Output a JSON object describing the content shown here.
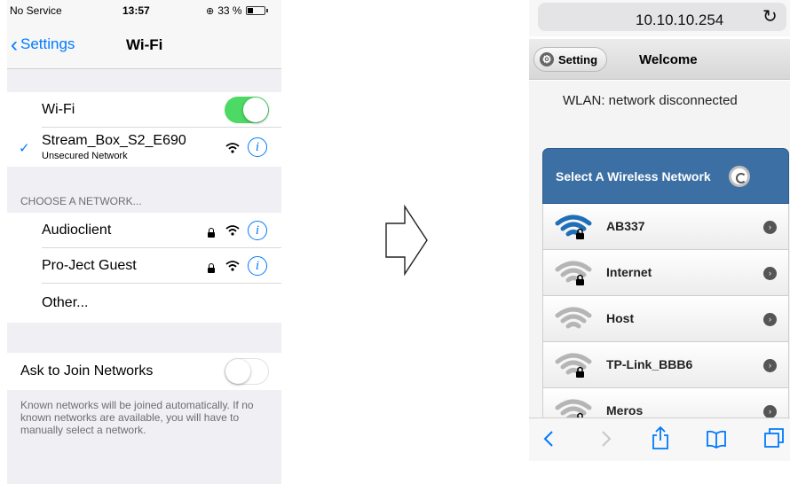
{
  "ios": {
    "status": {
      "carrier": "No Service",
      "time": "13:57",
      "battery": "33 %",
      "battery_level": 0.33
    },
    "nav": {
      "back_label": "Settings",
      "title": "Wi-Fi"
    },
    "wifi_row": {
      "label": "Wi-Fi",
      "toggle": "on"
    },
    "connected": {
      "name": "Stream_Box_S2_E690",
      "subtitle": "Unsecured Network"
    },
    "section_header": "CHOOSE A NETWORK...",
    "networks": [
      {
        "name": "Audioclient",
        "locked": true
      },
      {
        "name": "Pro-Ject Guest",
        "locked": true
      }
    ],
    "other_label": "Other...",
    "ask_join": {
      "label": "Ask to Join Networks",
      "toggle": "off"
    },
    "footnote": "Known networks will be joined automatically. If no known networks are available, you will have to manually select a network.",
    "colors": {
      "accent": "#007aff",
      "toggle_on": "#4cd964",
      "background": "#efeff4"
    }
  },
  "browser": {
    "url": "10.10.10.254",
    "header": {
      "setting_label": "Setting",
      "title": "Welcome"
    },
    "wlan_status": "WLAN: network disconnected",
    "select_header": "Select A Wireless Network",
    "networks": [
      {
        "name": "AB337",
        "strength": "strong",
        "locked": true
      },
      {
        "name": "Internet",
        "strength": "weak",
        "locked": true
      },
      {
        "name": "Host",
        "strength": "weak",
        "locked": false
      },
      {
        "name": "TP-Link_BBB6",
        "strength": "weak",
        "locked": true
      },
      {
        "name": "Meros",
        "strength": "weak",
        "locked": true
      }
    ],
    "toolbar_icons": [
      "back-icon",
      "forward-icon",
      "share-icon",
      "bookmarks-icon",
      "tabs-icon"
    ],
    "colors": {
      "header_blue": "#3c6fa3",
      "wifi_strong": "#1f6fb8",
      "wifi_weak": "#b5b5b5"
    }
  }
}
